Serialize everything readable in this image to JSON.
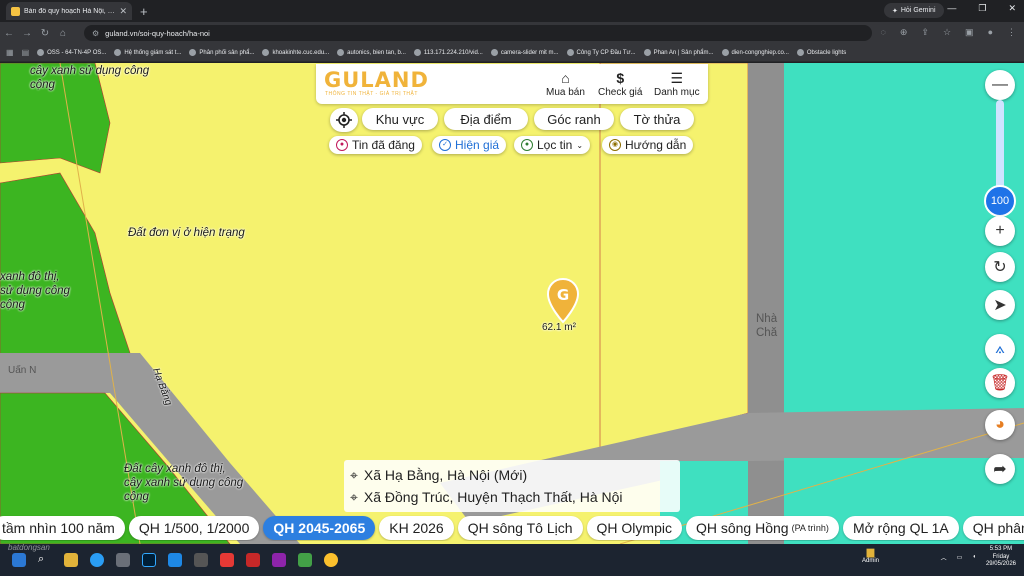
{
  "browser": {
    "tab_title": "Bản đồ quy hoạch Hà Nội, tra c...",
    "url": "guland.vn/soi-quy-hoach/ha-noi",
    "gemini_label": "Hỏi Gemini",
    "bookmarks": [
      "OSS - 64-TN-4P OS...",
      "Hệ thống giám sát t...",
      "Phân phối sản phẩ...",
      "khoakinhte.cuc.edu...",
      "autonics, bien tan, b...",
      "113.171.224.210/vid...",
      "camera-slider mit m...",
      "Công Ty CP Đầu Tư...",
      "Phan An | Sản phẩm...",
      "dien-congnghiep.co...",
      "Obstacle lights"
    ]
  },
  "header": {
    "logo": "GULAND",
    "logo_sub": "THÔNG TIN THẬT - GIÁ TRỊ THẬT",
    "buy_sell": "Mua bán",
    "check_price": "Check giá",
    "menu": "Danh mục"
  },
  "filters": {
    "area": "Khu vực",
    "place": "Địa điểm",
    "boundary": "Góc ranh",
    "parcel": "Tờ thửa"
  },
  "toggles": {
    "posted": "Tin đã đăng",
    "show_price": "Hiện giá",
    "filter_news": "Lọc tin",
    "guide": "Hướng dẫn"
  },
  "map": {
    "labels": {
      "green_top": "cây xanh sử dụng công\ncộng",
      "residential": "Đất đơn vị ở hiện trạng",
      "green_left": "xanh đô thị,\nsử dụng công\ncộng",
      "green_bottom": "Đất cây xanh đô thị,\ncây xanh sử dụng công\ncộng",
      "road": "Hạ Bằng",
      "building": "Nhà\nChă",
      "left_marker": "Uấn N"
    },
    "marker_area": "62.1 m²",
    "zoom": "100"
  },
  "address": {
    "line1": "Xã Hạ Bằng, Hà Nội (Mới)",
    "line2": "Xã Đồng Trúc, Huyện Thạch Thất, Hà Nội"
  },
  "layers": [
    {
      "label": "tầm nhìn 100 năm",
      "note": "",
      "active": false
    },
    {
      "label": "QH 1/500, 1/2000",
      "note": "",
      "active": false
    },
    {
      "label": "QH 2045-2065",
      "note": "",
      "active": true
    },
    {
      "label": "KH 2026",
      "note": "",
      "active": false
    },
    {
      "label": "QH sông Tô Lịch",
      "note": "",
      "active": false
    },
    {
      "label": "QH Olympic",
      "note": "",
      "active": false
    },
    {
      "label": "QH sông Hồng",
      "note": "(PA trình)",
      "active": false
    },
    {
      "label": "Mở rộng QL 1A",
      "note": "",
      "active": false
    },
    {
      "label": "QH phân l",
      "note": "",
      "active": false
    }
  ],
  "taskbar": {
    "admin": "Admin",
    "time": "5:53 PM",
    "day": "Friday",
    "date": "29/05/2026"
  },
  "watermark": "batdongsan",
  "colors": {
    "yellow_zone": "#f5f26e",
    "green_zone": "#3cb521",
    "teal_zone": "#3fe0c0",
    "road": "#9a9a9a",
    "active_layer": "#2d7fe0",
    "brand": "#f0b33a"
  }
}
